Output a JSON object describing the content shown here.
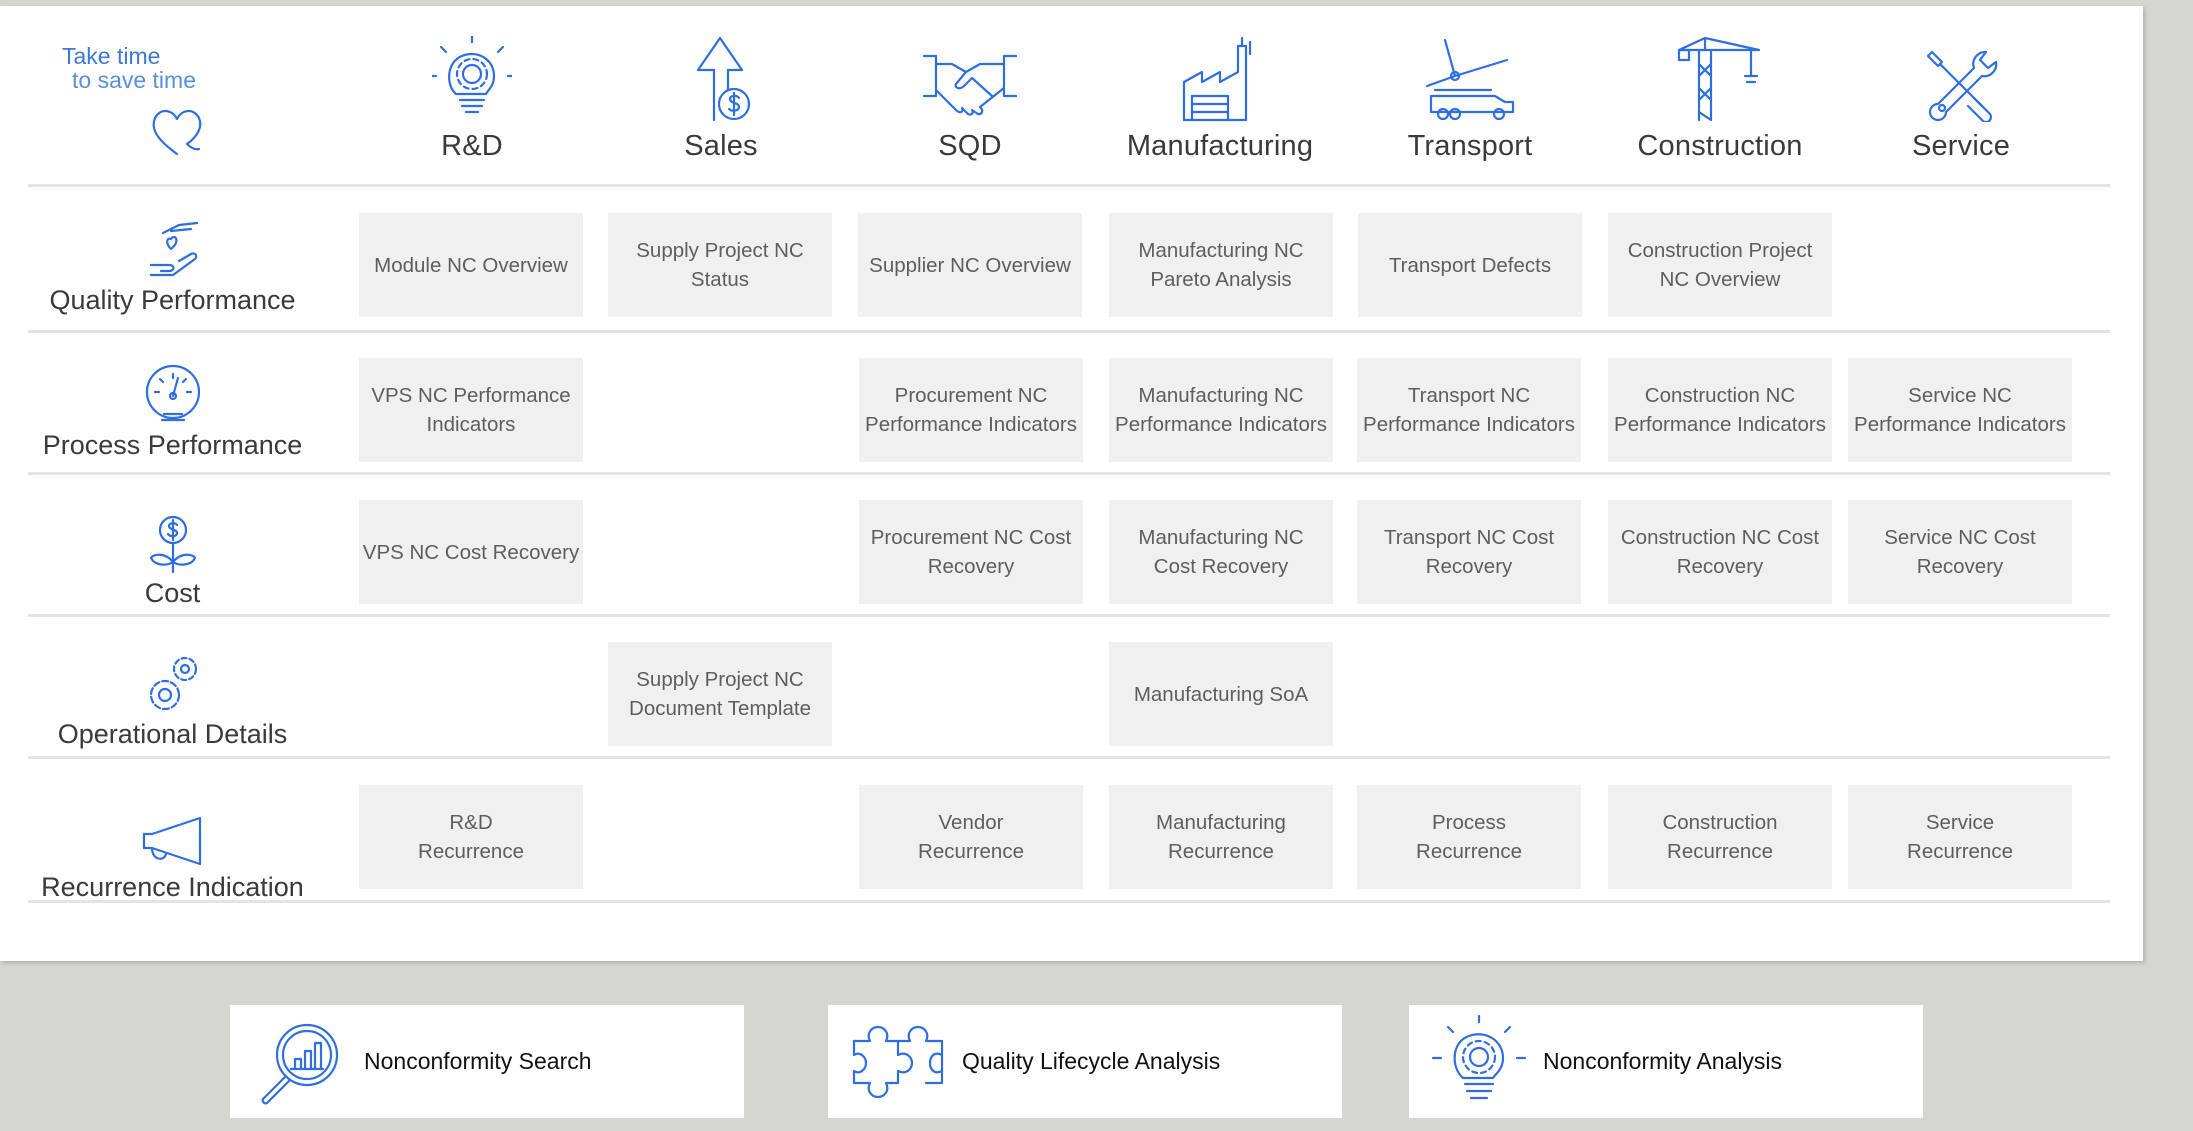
{
  "tagline": {
    "line1": "Take time",
    "line2": "to save time"
  },
  "columns": [
    {
      "label": "R&D",
      "icon": "gear-lightbulb-icon"
    },
    {
      "label": "Sales",
      "icon": "arrow-up-dollar-icon"
    },
    {
      "label": "SQD",
      "icon": "handshake-icon"
    },
    {
      "label": "Manufacturing",
      "icon": "factory-icon"
    },
    {
      "label": "Transport",
      "icon": "wind-turbine-truck-icon"
    },
    {
      "label": "Construction",
      "icon": "crane-icon"
    },
    {
      "label": "Service",
      "icon": "wrench-screwdriver-icon"
    }
  ],
  "rows": [
    {
      "label": "Quality Performance",
      "icon": "hand-heart-icon"
    },
    {
      "label": "Process Performance",
      "icon": "speedometer-icon"
    },
    {
      "label": "Cost",
      "icon": "money-plant-icon"
    },
    {
      "label": "Operational Details",
      "icon": "gears-icon"
    },
    {
      "label": "Recurrence Indication",
      "icon": "megaphone-icon"
    }
  ],
  "tiles": {
    "quality": {
      "rd": "Module NC Overview",
      "sales": "Supply Project NC\nStatus",
      "sqd": "Supplier NC Overview",
      "manufacturing": "Manufacturing NC\nPareto Analysis",
      "transport": "Transport Defects",
      "construction": "Construction Project\nNC Overview"
    },
    "process": {
      "rd": "VPS NC Performance\nIndicators",
      "sqd": "Procurement NC\nPerformance Indicators",
      "manufacturing": "Manufacturing NC\nPerformance Indicators",
      "transport": "Transport NC\nPerformance Indicators",
      "construction": "Construction NC\nPerformance Indicators",
      "service": "Service NC\nPerformance Indicators"
    },
    "cost": {
      "rd": "VPS NC Cost Recovery",
      "sqd": "Procurement NC Cost\nRecovery",
      "manufacturing": "Manufacturing NC\nCost Recovery",
      "transport": "Transport NC Cost\nRecovery",
      "construction": "Construction NC Cost\nRecovery",
      "service": "Service NC Cost\nRecovery"
    },
    "operational": {
      "sales": "Supply Project NC\nDocument Template",
      "manufacturing": "Manufacturing SoA"
    },
    "recurrence": {
      "rd": "R&D\nRecurrence",
      "sqd": "Vendor\nRecurrence",
      "manufacturing": "Manufacturing\nRecurrence",
      "transport": "Process\nRecurrence",
      "construction": "Construction\nRecurrence",
      "service": "Service\nRecurrence"
    }
  },
  "bottom_buttons": [
    {
      "label": "Nonconformity Search",
      "icon": "magnifier-chart-icon"
    },
    {
      "label": "Quality Lifecycle Analysis",
      "icon": "puzzle-icon"
    },
    {
      "label": "Nonconformity Analysis",
      "icon": "gear-lightbulb-icon"
    }
  ],
  "colors": {
    "accent": "#2f6ee0",
    "tile_bg": "#f0f0f0",
    "tile_text": "#5e5e5e",
    "page_bg": "#d5d6d2"
  }
}
